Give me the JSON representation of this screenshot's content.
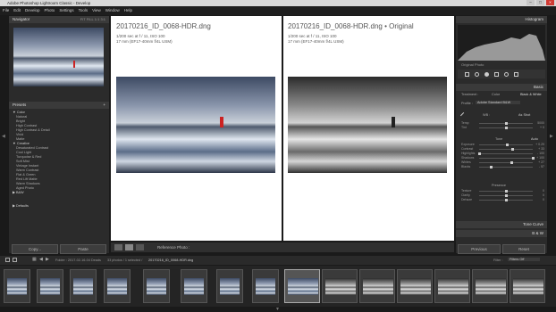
{
  "window": {
    "title": "Adobe Photoshop Lightroom Classic - Develop"
  },
  "menus": [
    "File",
    "Edit",
    "Develop",
    "Photo",
    "Settings",
    "Tools",
    "View",
    "Window",
    "Help"
  ],
  "navigator": {
    "title": "Navigator",
    "zoom": [
      "FIT",
      "FILL",
      "1:1",
      "3:1"
    ]
  },
  "presets": {
    "title": "Presets",
    "groups": [
      {
        "name": "Color",
        "items": [
          "Natural",
          "Bright",
          "High Contrast",
          "High Contrast & Detail",
          "Vivid",
          "Matte"
        ]
      },
      {
        "name": "Creative",
        "items": [
          "Desaturated Contrast",
          "Cool Light",
          "Turquoise & Red",
          "Soft Mist",
          "Vintage Instant",
          "Warm Contrast",
          "Flat & Green",
          "Red Lift Matte",
          "Warm Shadows",
          "Aged Photo"
        ]
      },
      {
        "name": "B&W",
        "items": []
      },
      {
        "name": "Defaults",
        "items": []
      }
    ]
  },
  "left_buttons": {
    "copy": "Copy...",
    "paste": "Paste"
  },
  "views": {
    "before": {
      "filename": "20170216_ID_0068-HDR.dng",
      "exif1": "1/200 sec at f / 11, ISO 100",
      "exif2": "17 mm (EF17-40mm f/4L USM)"
    },
    "after": {
      "filename": "20170216_ID_0068-HDR.dng • Original",
      "exif1": "1/200 sec at f / 11, ISO 100",
      "exif2": "17 mm (EF17-40mm f/4L USM)"
    }
  },
  "toolbar": {
    "reference_label": "Reference Photo :"
  },
  "right": {
    "histogram_title": "Histogram",
    "original_photo": "Original Photo",
    "basic_title": "Basic",
    "treatment_label": "Treatment :",
    "treatment_color": "Color",
    "treatment_bw": "Black & White",
    "profile_label": "Profile :",
    "profile_value": "Adobe Standard B&W",
    "wb_label": "WB :",
    "wb_value": "As Shot",
    "tone_label": "Tone",
    "tone_auto": "Auto",
    "presence_label": "Presence",
    "sliders_wb": [
      {
        "label": "Temp",
        "value": "5000",
        "level": 0.5
      },
      {
        "label": "Tint",
        "value": "+ 0",
        "level": 0.5
      }
    ],
    "sliders_tone": [
      {
        "label": "Exposure",
        "value": "+ 0.29",
        "level": 0.53
      },
      {
        "label": "Contrast",
        "value": "+ 33",
        "level": 0.62
      },
      {
        "label": "Highlights",
        "value": "- 100",
        "level": 0.0
      },
      {
        "label": "Shadows",
        "value": "+ 100",
        "level": 1.0
      },
      {
        "label": "Whites",
        "value": "+ 27",
        "level": 0.6
      },
      {
        "label": "Blacks",
        "value": "- 57",
        "level": 0.22
      }
    ],
    "sliders_presence": [
      {
        "label": "Texture",
        "value": "0",
        "level": 0.5
      },
      {
        "label": "Clarity",
        "value": "0",
        "level": 0.5
      },
      {
        "label": "Dehaze",
        "value": "0",
        "level": 0.5
      }
    ],
    "tone_curve": "Tone Curve",
    "bw": "B & W",
    "previous": "Previous",
    "reset": "Reset"
  },
  "filmstrip": {
    "folder": "Folder : 2017-02-16-04 Deads",
    "count": "33 photos / 1 selected /",
    "selected": "20170216_ID_0068-HDR.dng",
    "filter_label": "Filter :",
    "filter_value": "Filters Off"
  }
}
